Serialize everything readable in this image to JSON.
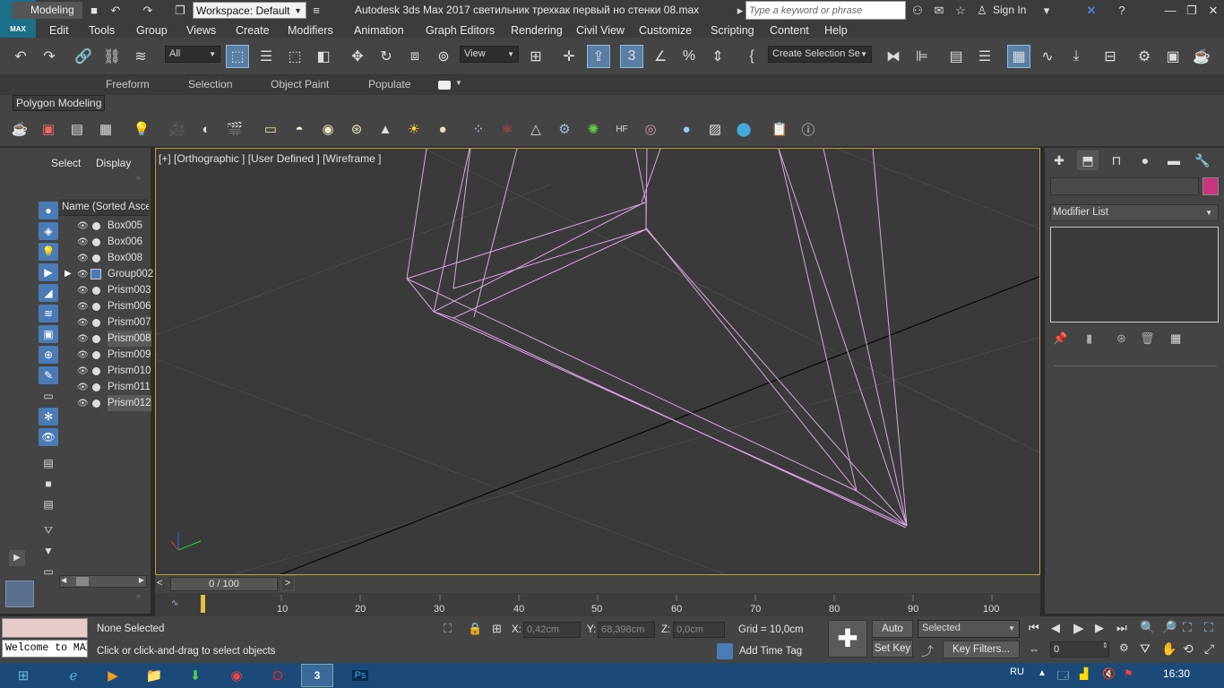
{
  "app": {
    "logo_main": "3",
    "logo_sub": "MAX",
    "workspace": "Workspace: Default",
    "title": "Autodesk 3ds Max 2017    светильник трехкак первый но стенки 08.max",
    "search_placeholder": "Type a keyword or phrase",
    "sign_in": "Sign In"
  },
  "menu": [
    "Edit",
    "Tools",
    "Group",
    "Views",
    "Create",
    "Modifiers",
    "Animation",
    "Graph Editors",
    "Rendering",
    "Civil View",
    "Customize",
    "Scripting",
    "Content",
    "Help"
  ],
  "toolbar": {
    "filter_value": "All",
    "view_value": "View",
    "named_selection": "Create Selection Se"
  },
  "ribbon": {
    "tabs": [
      "Modeling",
      "Freeform",
      "Selection",
      "Object Paint",
      "Populate"
    ],
    "panel_label": "Polygon Modeling"
  },
  "scene_explorer": {
    "tabs": [
      "Select",
      "Display"
    ],
    "column_header": "Name (Sorted Ascending)",
    "objects": [
      {
        "name": "Box005",
        "type": "object",
        "selected": false
      },
      {
        "name": "Box006",
        "type": "object",
        "selected": false
      },
      {
        "name": "Box008",
        "type": "object",
        "selected": false
      },
      {
        "name": "Group002",
        "type": "group",
        "selected": false
      },
      {
        "name": "Prism003",
        "type": "object",
        "selected": false
      },
      {
        "name": "Prism006",
        "type": "object",
        "selected": false
      },
      {
        "name": "Prism007",
        "type": "object",
        "selected": false
      },
      {
        "name": "Prism008",
        "type": "object",
        "selected": true
      },
      {
        "name": "Prism009",
        "type": "object",
        "selected": false
      },
      {
        "name": "Prism010",
        "type": "object",
        "selected": false
      },
      {
        "name": "Prism011",
        "type": "object",
        "selected": false
      },
      {
        "name": "Prism012",
        "type": "object",
        "selected": true
      }
    ]
  },
  "viewport": {
    "label": "[+] [Orthographic ] [User Defined ] [Wireframe ]",
    "wire_color": "#d9a6e0"
  },
  "command_panel": {
    "modifier_list": "Modifier List",
    "object_color": "#c8357d"
  },
  "timeline": {
    "position": "0 / 100",
    "ticks": [
      "10",
      "20",
      "30",
      "40",
      "50",
      "60",
      "70",
      "80",
      "90",
      "100"
    ]
  },
  "status": {
    "selection": "None Selected",
    "prompt": "Click or click-and-drag to select objects",
    "maxscript": "Welcome to MAXScript.",
    "x_label": "X:",
    "x_value": "0,42cm",
    "y_label": "Y:",
    "y_value": "68,398cm",
    "z_label": "Z:",
    "z_value": "0,0cm",
    "grid": "Grid = 10,0cm",
    "add_time_tag": "Add Time Tag",
    "auto_key": "Auto Key",
    "set_key": "Set Key",
    "selected_dropdown": "Selected",
    "key_filters": "Key Filters...",
    "frame_value": "0"
  },
  "taskbar": {
    "language": "RU",
    "time": "16:30"
  }
}
